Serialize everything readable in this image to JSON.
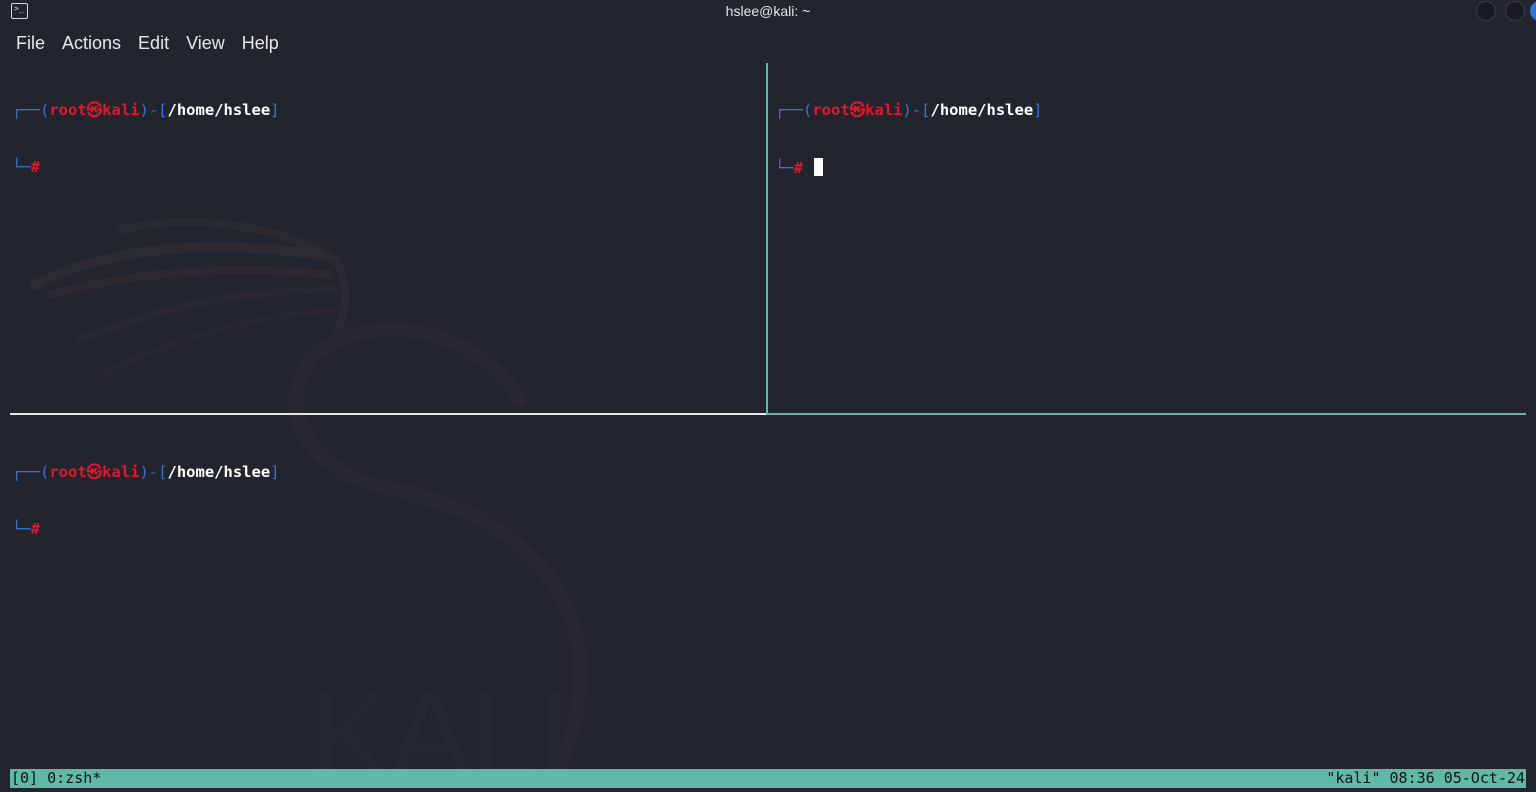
{
  "window": {
    "title": "hslee@kali: ~",
    "icon": "terminal-icon",
    "controls": [
      "minimize-button",
      "maximize-button",
      "close-button"
    ],
    "accent_color": "#2a77d6"
  },
  "menu": {
    "items": [
      {
        "label": "File"
      },
      {
        "label": "Actions"
      },
      {
        "label": "Edit"
      },
      {
        "label": "View"
      },
      {
        "label": "Help"
      }
    ]
  },
  "prompt": {
    "open_paren": "┌──(",
    "user": "root",
    "at_symbol": "㉿",
    "host": "kali",
    "mid": ")-[",
    "path": "/home/hslee",
    "close": "]",
    "second_line_prefix": "└─",
    "hash": "#"
  },
  "panes": [
    {
      "id": "top-left",
      "active": false,
      "has_cursor": false
    },
    {
      "id": "top-right",
      "active": true,
      "has_cursor": true
    },
    {
      "id": "bottom",
      "active": false,
      "has_cursor": false
    }
  ],
  "watermark_text": "KALI",
  "statusbar": {
    "left": "[0] 0:zsh*",
    "right": "\"kali\" 08:36 05-Oct-24",
    "color": "#5fb8a8"
  },
  "colors": {
    "background": "#23252e",
    "prompt_frame": "#3d6fd6",
    "prompt_user": "#e0182a",
    "pane_border_active": "#5fb8a8"
  }
}
